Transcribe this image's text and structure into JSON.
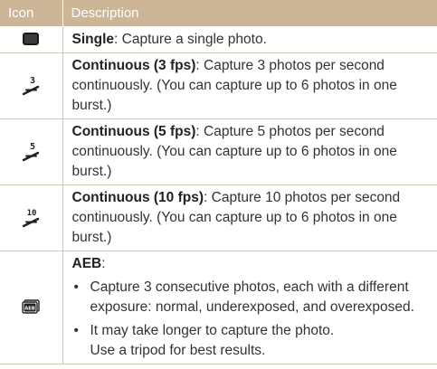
{
  "header": {
    "icon_col": "Icon",
    "description_col": "Description"
  },
  "rows": [
    {
      "icon": "single-shot-icon",
      "term": "Single",
      "text": ": Capture a single photo."
    },
    {
      "icon": "continuous-3fps-icon",
      "icon_number": "3",
      "term": "Continuous (3 fps)",
      "text": ": Capture 3 photos per second continuously. (You can capture up to 6 photos in one burst.)"
    },
    {
      "icon": "continuous-5fps-icon",
      "icon_number": "5",
      "term": "Continuous (5 fps)",
      "text": ": Capture 5 photos per second continuously. (You can capture up to 6 photos in one burst.)"
    },
    {
      "icon": "continuous-10fps-icon",
      "icon_number": "10",
      "term": "Continuous (10 fps)",
      "text": ": Capture 10 photos per second continuously. (You can capture up to 6 photos in one burst.)"
    },
    {
      "icon": "aeb-icon",
      "icon_label": "AEB",
      "term": "AEB",
      "text": ":",
      "bullets": [
        "Capture 3 consecutive photos, each with a different exposure: normal, underexposed, and overexposed.",
        "It may take longer to capture the photo.",
        "Use a tripod for best results."
      ]
    }
  ],
  "colors": {
    "header_bg": "#cdb697",
    "header_text": "#ffffff",
    "rule": "#cfc6b6"
  }
}
